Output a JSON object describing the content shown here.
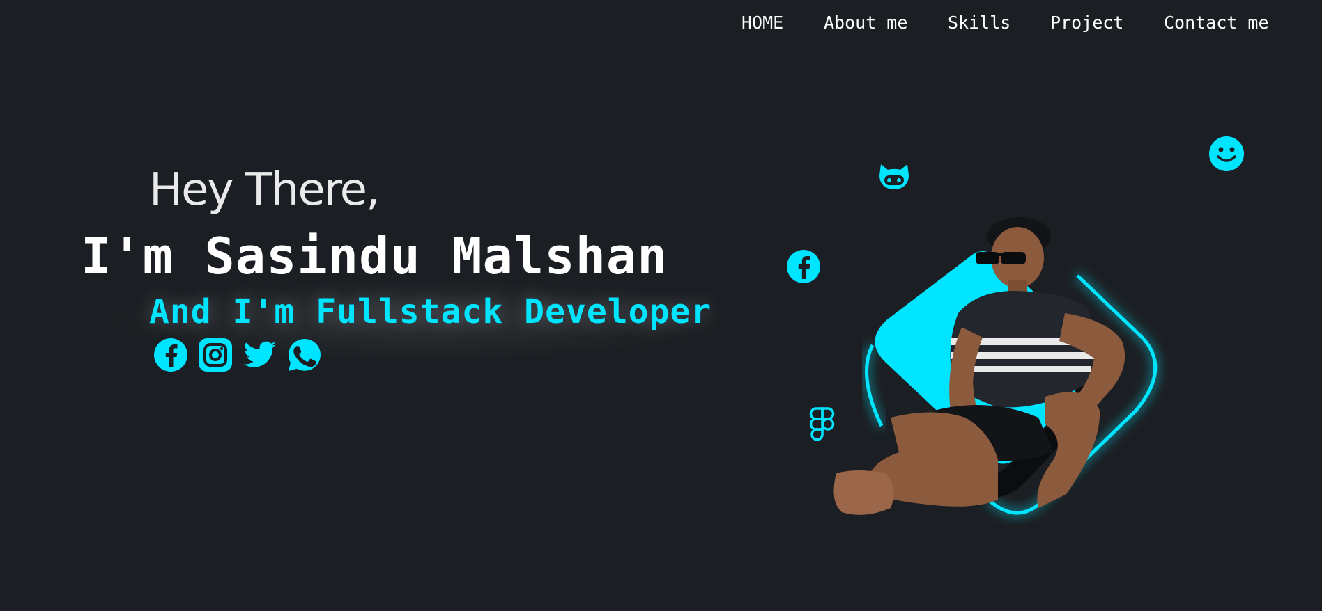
{
  "nav": {
    "items": [
      {
        "label": "HOME"
      },
      {
        "label": "About me"
      },
      {
        "label": "Skills"
      },
      {
        "label": "Project"
      },
      {
        "label": "Contact me"
      }
    ]
  },
  "hero": {
    "greeting": "Hey There,",
    "name": "I'm Sasindu Malshan",
    "role": "And I'm Fullstack Developer",
    "socials": [
      {
        "icon": "facebook-icon"
      },
      {
        "icon": "instagram-icon"
      },
      {
        "icon": "twitter-icon"
      },
      {
        "icon": "whatsapp-icon"
      }
    ]
  },
  "floating_icons": [
    "github-icon",
    "smiley-icon",
    "facebook-icon",
    "figma-icon"
  ],
  "colors": {
    "background": "#1b1f23",
    "accent": "#00e5ff",
    "text": "#ffffff"
  }
}
